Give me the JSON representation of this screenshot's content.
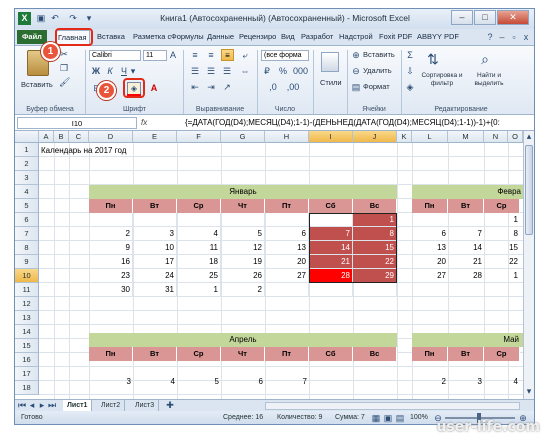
{
  "window": {
    "title": "Книга1 (Автосохраненный) (Автосохраненный) - Microsoft Excel",
    "minimize": "–",
    "maximize": "□",
    "close": "✕"
  },
  "tabs": [
    "Файл",
    "Главная",
    "Вставка",
    "Разметка с",
    "Формулы",
    "Данные",
    "Рецензиро",
    "Вид",
    "Разработ",
    "Надстрой",
    "Foxit PDF",
    "ABBYY PDF"
  ],
  "ribbon": {
    "paste": "Вставить",
    "clipboard": "Буфер обмена",
    "font_name": "Calibri",
    "font_size": "11",
    "font_group": "Шрифт",
    "align_group": "Выравнивание",
    "number_format": "(все форма",
    "number_group": "Число",
    "styles": "Стили",
    "insert": "Вставить",
    "delete": "Удалить",
    "format": "Формат",
    "cells_group": "Ячейки",
    "sort": "Сортировка и фильтр",
    "find": "Найти и выделить",
    "editing_group": "Редактирование",
    "callout1": "1",
    "callout2": "2"
  },
  "formula_bar": {
    "name_box": "I10",
    "fx": "fx",
    "formula": "{=ДАТА(ГОД(D4);МЕСЯЦ(D4);1-1)-(ДЕНЬНЕД(ДАТА(ГОД(D4);МЕСЯЦ(D4);1-1))-1)+{0:"
  },
  "columns": [
    "A",
    "B",
    "C",
    "D",
    "E",
    "F",
    "G",
    "H",
    "I",
    "J",
    "K",
    "L",
    "M",
    "N",
    "O"
  ],
  "rows": [
    "1",
    "2",
    "3",
    "4",
    "5",
    "6",
    "7",
    "8",
    "9",
    "10",
    "11",
    "12",
    "13",
    "14",
    "15",
    "16",
    "17",
    "18"
  ],
  "sheet": {
    "title": "Календарь на 2017 год",
    "months": {
      "january": "Январь",
      "february": "Февра",
      "april": "Апрель",
      "may": "Май"
    },
    "weekdays": [
      "Пн",
      "Вт",
      "Ср",
      "Чт",
      "Пт",
      "Сб",
      "Вс"
    ],
    "january_rows": [
      [
        "",
        "",
        "",
        "",
        "",
        "",
        "1"
      ],
      [
        "2",
        "3",
        "4",
        "5",
        "6",
        "7",
        "8"
      ],
      [
        "9",
        "10",
        "11",
        "12",
        "13",
        "14",
        "15"
      ],
      [
        "16",
        "17",
        "18",
        "19",
        "20",
        "21",
        "22"
      ],
      [
        "23",
        "24",
        "25",
        "26",
        "27",
        "28",
        "29"
      ],
      [
        "30",
        "31",
        "1",
        "2",
        "",
        "",
        ""
      ]
    ],
    "february_rows": [
      [
        "",
        "",
        "1"
      ],
      [
        "6",
        "7",
        "8"
      ],
      [
        "13",
        "14",
        "15"
      ],
      [
        "20",
        "21",
        "22"
      ],
      [
        "27",
        "28",
        "1"
      ],
      [
        "",
        "",
        ""
      ]
    ],
    "february_weekdays": [
      "Пн",
      "Вт",
      "Ср"
    ],
    "april_row17": [
      "3",
      "4",
      "5",
      "6",
      "7",
      "",
      ""
    ],
    "may_weekdays": [
      "Пн",
      "Вт",
      "Ср"
    ],
    "may_row17": [
      "2",
      "3",
      "4"
    ]
  },
  "sheet_tabs": [
    "Лист1",
    "Лист2",
    "Лист3"
  ],
  "status": {
    "ready": "Готово",
    "average": "Среднее: 16",
    "count": "Количество: 9",
    "sum": "Сумма: 7",
    "zoom": "100%"
  },
  "watermark": "user-life.com",
  "colors": {
    "weekend": "#c0504d",
    "selected": "#ff0000",
    "header": "#da9694",
    "month": "#c4d79b",
    "file_tab": "#2c6e31"
  }
}
